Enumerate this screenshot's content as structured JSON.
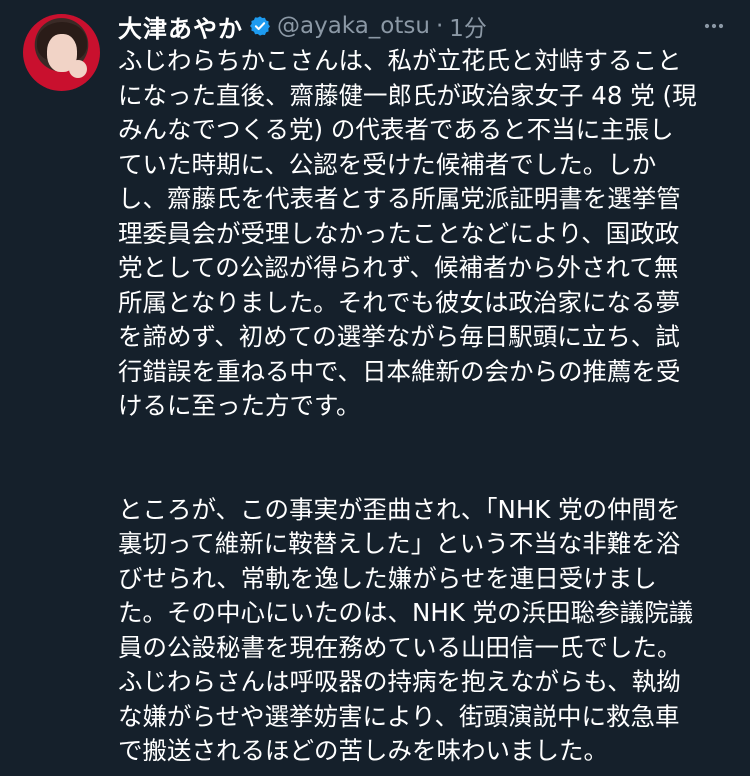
{
  "tweet": {
    "display_name": "大津あやか",
    "handle": "@ayaka_otsu",
    "separator": "·",
    "time": "1分",
    "paragraphs": [
      [
        "ふじわらちかこさんは、私が立花氏と対峙すること",
        "になった直後、齋藤健一郎氏が政治家女子 48 党 (現",
        "みんなでつくる党) の代表者であると不当に主張し",
        "ていた時期に、公認を受けた候補者でした。しか",
        "し、齋藤氏を代表者とする所属党派証明書を選挙管",
        "理委員会が受理しなかったことなどにより、国政政",
        "党としての公認が得られず、候補者から外されて無",
        "所属となりました。それでも彼女は政治家になる夢",
        "を諦めず、初めての選挙ながら毎日駅頭に立ち、試",
        "行錯誤を重ねる中で、日本維新の会からの推薦を受",
        "けるに至った方です。"
      ],
      [
        "ところが、この事実が歪曲され、「NHK 党の仲間を",
        "裏切って維新に鞍替えした」という不当な非難を浴",
        "びせられ、常軌を逸した嫌がらせを連日受けまし",
        "た。その中心にいたのは、NHK 党の浜田聡参議院議",
        "員の公設秘書を現在務めている山田信一氏でした。",
        "ふじわらさんは呼吸器の持病を抱えながらも、執拗",
        "な嫌がらせや選挙妨害により、街頭演説中に救急車",
        "で搬送されるほどの苦しみを味わいました。"
      ]
    ]
  },
  "icons": {
    "avatar": "profile-photo",
    "verified": "verified-badge-icon",
    "more": "more-options-icon"
  },
  "colors": {
    "background": "#15202b",
    "text": "#ffffff",
    "secondary_text": "#8b98a5",
    "verified_blue": "#1d9bf0"
  }
}
